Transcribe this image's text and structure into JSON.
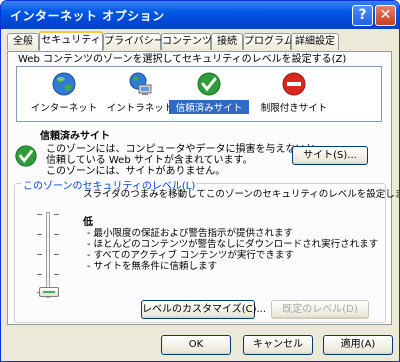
{
  "window": {
    "title": "インターネット オプション",
    "help_glyph": "?",
    "close_glyph": "✕"
  },
  "tabs": [
    {
      "label": "全般"
    },
    {
      "label": "セキュリティ"
    },
    {
      "label": "プライバシー"
    },
    {
      "label": "コンテンツ"
    },
    {
      "label": "接続"
    },
    {
      "label": "プログラム"
    },
    {
      "label": "詳細設定"
    }
  ],
  "instructions": "Web コンテンツのゾーンを選択してセキュリティのレベルを設定する(Z)",
  "zones": [
    {
      "label": "インターネット",
      "icon": "globe-icon"
    },
    {
      "label": "イントラネット",
      "icon": "intranet-icon"
    },
    {
      "label": "信頼済みサイト",
      "icon": "check-icon",
      "selected": true
    },
    {
      "label": "制限付きサイト",
      "icon": "restricted-icon"
    }
  ],
  "selected_zone": {
    "title": "信頼済みサイト",
    "desc_line1": "このゾーンには、コンピュータやデータに損害を与えないと",
    "desc_line2": "信頼している Web サイトが含まれています。",
    "desc_line3": "このゾーンには、サイトがありません。",
    "sites_button": "サイト(S)..."
  },
  "security_level": {
    "group_title": "このゾーンのセキュリティのレベル(L)",
    "instruction": "スライダのつまみを移動してこのゾーンのセキュリティのレベルを設定します。",
    "level_name": "低",
    "bullets": [
      "- 最小限度の保証および警告指示が提供されます",
      "- ほとんどのコンテンツが警告なしにダウンロードされ実行されます",
      "- すべてのアクティブ コンテンツが実行できます",
      "- サイトを無条件に信頼します"
    ],
    "custom_button": "レベルのカスタマイズ(C)...",
    "default_button": "既定のレベル(D)"
  },
  "footer": {
    "ok": "OK",
    "cancel": "キャンセル",
    "apply": "適用(A)"
  },
  "colors": {
    "accent": "#0046d5",
    "selection": "#316ac5",
    "titlebar": "#0058e6"
  }
}
